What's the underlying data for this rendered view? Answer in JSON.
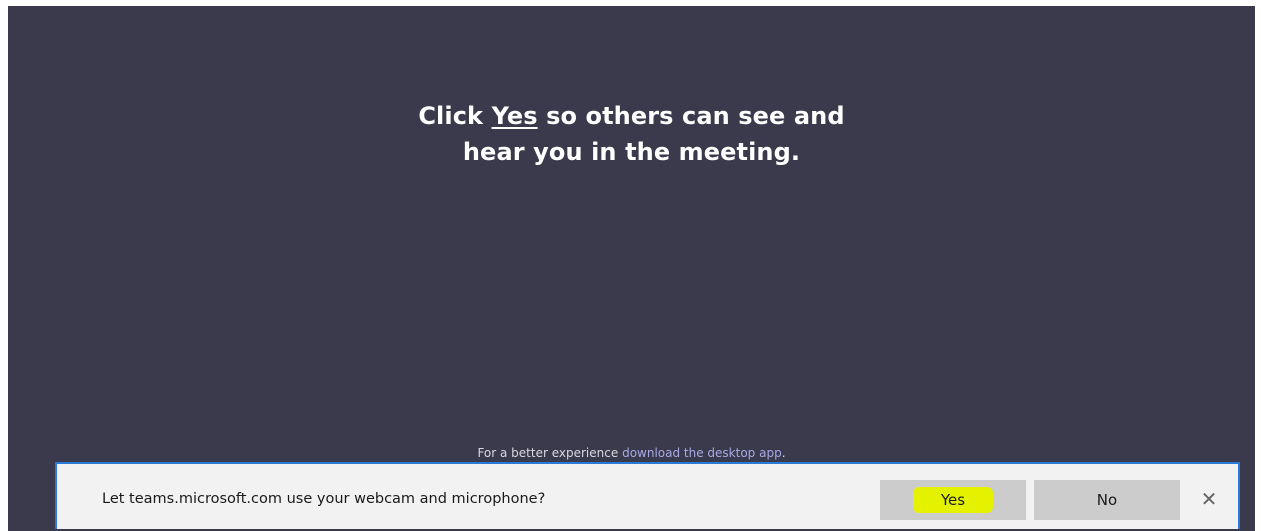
{
  "main": {
    "prompt_click": "Click",
    "prompt_yes": "Yes",
    "prompt_rest_line1": "so others can see and",
    "prompt_line2": "hear you in the meeting.",
    "better_prefix": "For a better experience",
    "better_link": "download the desktop app",
    "better_suffix": "."
  },
  "permission_bar": {
    "question": "Let teams.microsoft.com use your webcam and microphone?",
    "yes_label": "Yes",
    "no_label": "No",
    "close_icon": "close-icon"
  },
  "colors": {
    "background": "#3b3a4c",
    "bar_border": "#2a7bd8",
    "yes_highlight": "#e4f200",
    "link": "#a7a9e6"
  }
}
